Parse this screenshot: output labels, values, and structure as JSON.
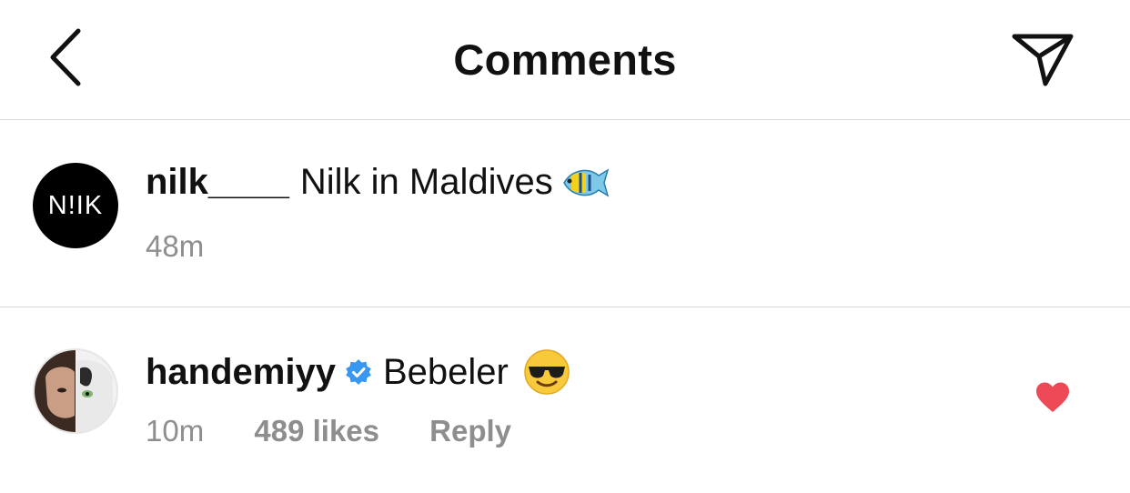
{
  "header": {
    "title": "Comments",
    "back_icon": "chevron-left-icon",
    "send_icon": "paper-plane-icon"
  },
  "caption": {
    "avatar_text": "N!IK",
    "username": "nilk____",
    "text": "Nilk in Maldives",
    "emoji": "tropical-fish-emoji",
    "time": "48m"
  },
  "comment": {
    "username": "handemiyy",
    "verified": true,
    "text": "Bebeler",
    "emoji": "sunglasses-emoji",
    "time": "10m",
    "likes": "489 likes",
    "reply_label": "Reply",
    "liked": true
  },
  "colors": {
    "heart": "#ed4956",
    "verified": "#3897f0",
    "meta_text": "#8e8e8e",
    "divider": "#dbdbdb"
  }
}
